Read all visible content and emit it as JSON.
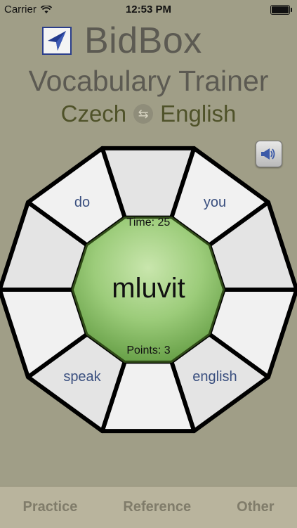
{
  "status_bar": {
    "carrier": "Carrier",
    "time": "12:53 PM",
    "icons": [
      "wifi-icon",
      "battery-icon"
    ]
  },
  "header": {
    "app_name": "BidBox",
    "subtitle": "Vocabulary Trainer",
    "source_language": "Czech",
    "target_language": "English",
    "swap_icon": "swap-arrows-icon",
    "speaker_icon": "speaker-icon"
  },
  "board": {
    "time_label": "Time: 25",
    "points_label": "Points: 3",
    "prompt_word": "mluvit",
    "options": {
      "top_left": "do",
      "top_right": "you",
      "bottom_left": "speak",
      "bottom_right": "english"
    }
  },
  "tabs": [
    "Practice",
    "Reference",
    "Other"
  ],
  "colors": {
    "background": "#a09e87",
    "center": "#8dbf6a",
    "option_text": "#3a4f7f",
    "tabbar": "#b9b49d"
  }
}
